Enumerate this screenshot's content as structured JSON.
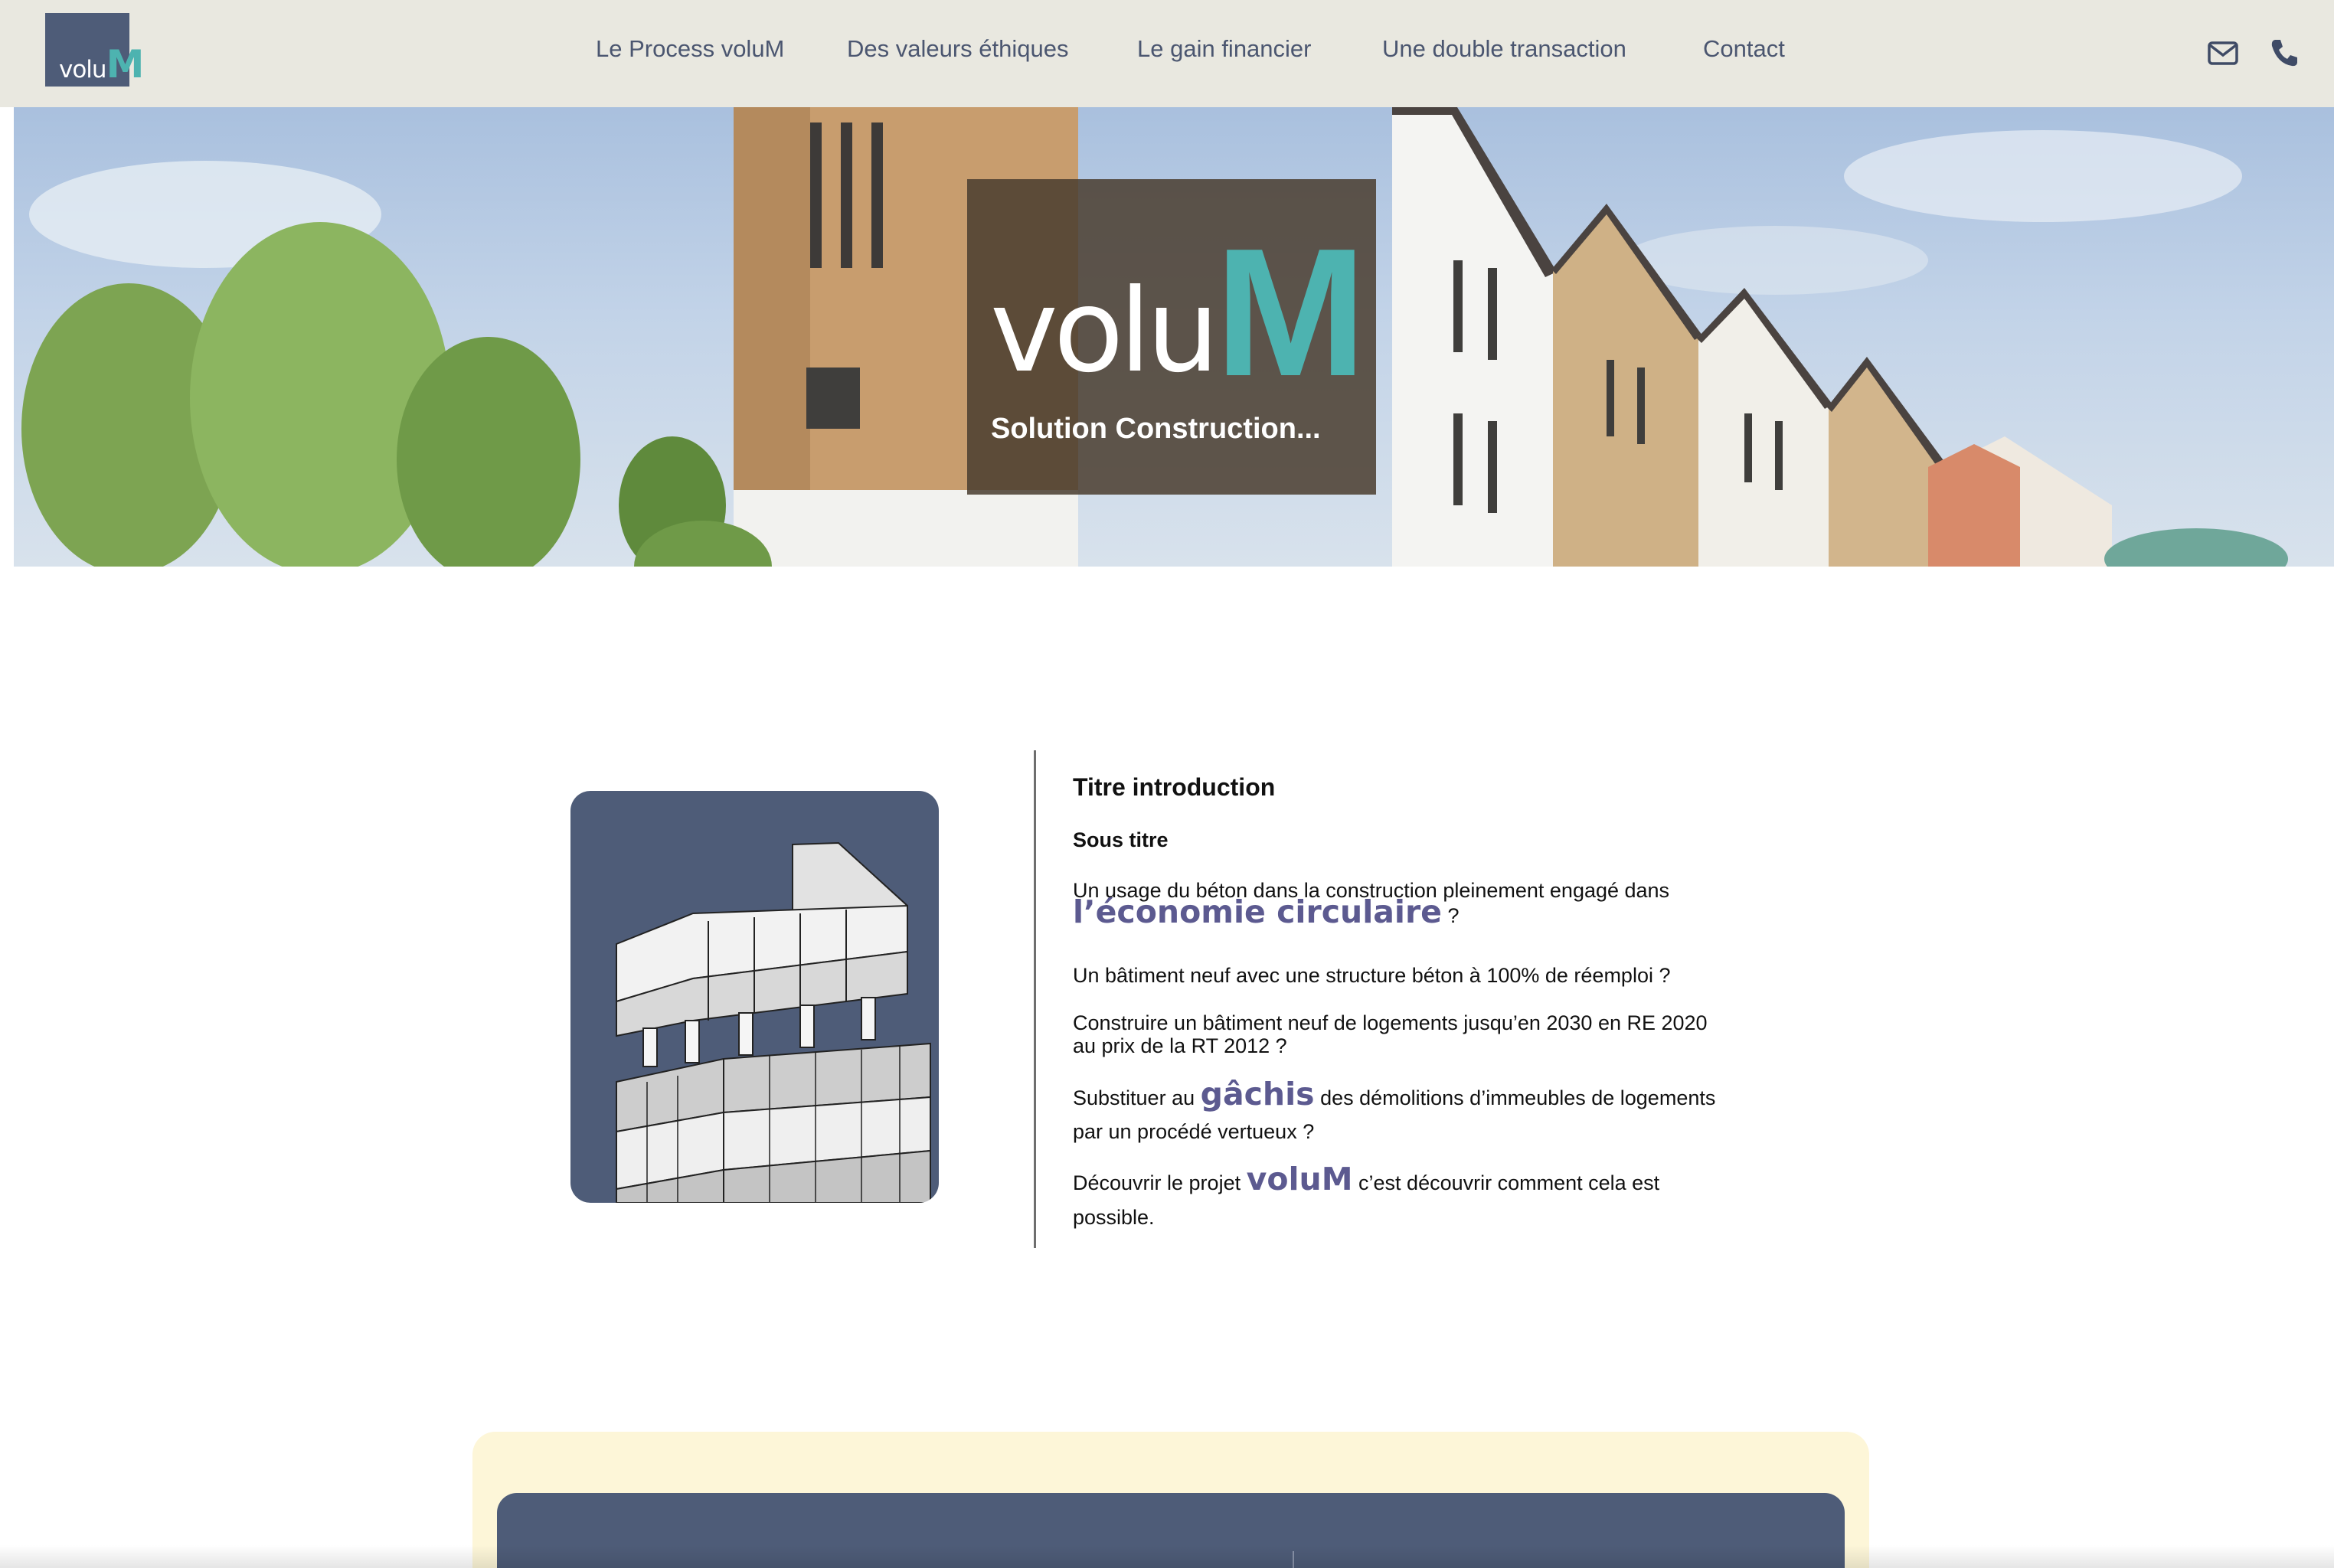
{
  "brand": {
    "name_part1": "volu",
    "name_part2": "M",
    "accent_color": "#4db3b0",
    "primary_color": "#4e5c78"
  },
  "nav": {
    "items": [
      {
        "label": "Le Process voluM"
      },
      {
        "label": "Des valeurs éthiques"
      },
      {
        "label": "Le gain financier"
      },
      {
        "label": "Une double transaction"
      },
      {
        "label": "Contact"
      }
    ],
    "icons": [
      "mail-icon",
      "phone-icon"
    ]
  },
  "hero": {
    "logo_part1": "volu",
    "logo_part2": "M",
    "subtitle": "Solution Construction..."
  },
  "intro": {
    "title": "Titre introduction",
    "subtitle": "Sous titre",
    "p1_line1": "Un usage du béton dans la construction pleinement engagé dans",
    "p1_highlight": "l’économie circulaire",
    "p1_end": " ?",
    "p2": "Un bâtiment neuf avec une structure béton à 100% de réemploi ?",
    "p3_line1": "Construire un bâtiment neuf de logements jusqu’en 2030 en RE 2020",
    "p3_line2": "au prix de la RT 2012 ?",
    "p4_start": "Substituer au ",
    "p4_highlight": "gâchis",
    "p4_end": " des démolitions d’immeubles de logements",
    "p4_line2": "par un procédé vertueux ?",
    "p5_start": "Découvrir le projet ",
    "p5_highlight": "voluM",
    "p5_end": " c’est découvrir comment cela est",
    "p5_line2": "possible."
  }
}
